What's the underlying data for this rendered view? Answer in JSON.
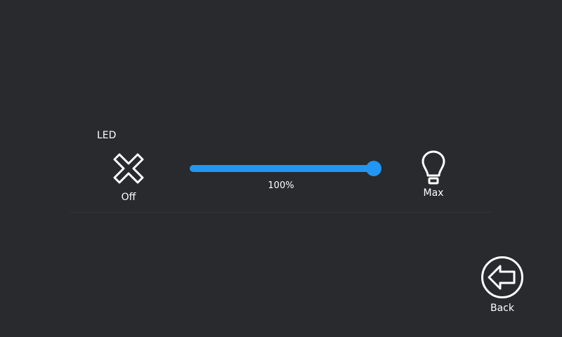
{
  "section": {
    "title": "LED"
  },
  "controls": {
    "off": {
      "label": "Off",
      "icon": "close-x-icon"
    },
    "max": {
      "label": "Max",
      "icon": "light-bulb-icon"
    },
    "back": {
      "label": "Back",
      "icon": "back-arrow-icon"
    }
  },
  "slider": {
    "value_percent": 100,
    "value_text": "100%"
  },
  "colors": {
    "background": "#282a2e",
    "accent": "#2196f3",
    "text": "#ffffff"
  }
}
